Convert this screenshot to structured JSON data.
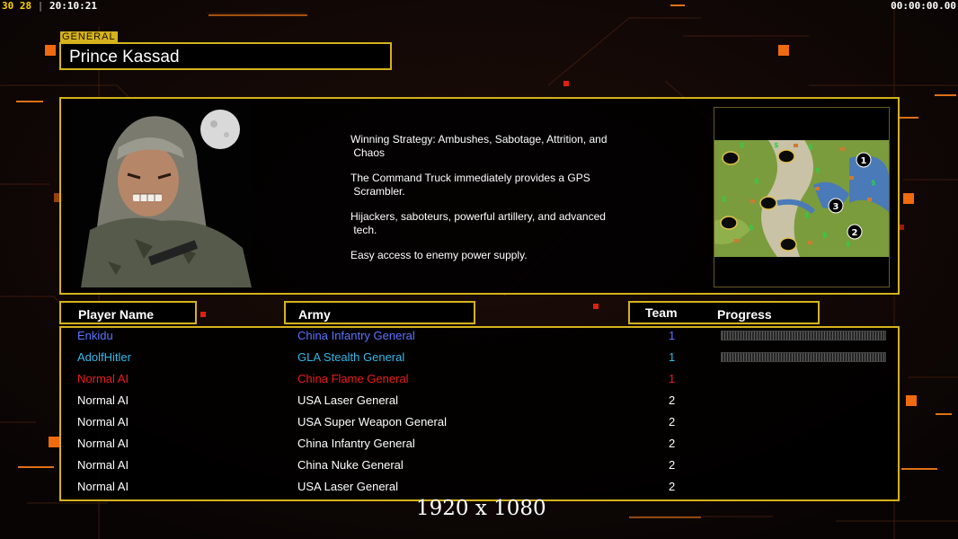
{
  "hud": {
    "fps": "30 28",
    "clock": "20:10:21",
    "timer": "00:00:00.00"
  },
  "general": {
    "label": "GENERAL",
    "name": "Prince Kassad",
    "strategy": [
      "Winning Strategy: Ambushes, Sabotage, Attrition, and\n Chaos",
      "The Command Truck immediately provides a GPS\n Scrambler.",
      "Hijackers, saboteurs, powerful artillery, and advanced\n tech.",
      "Easy access to enemy power supply."
    ]
  },
  "map": {
    "markers": [
      "1",
      "2",
      "3"
    ]
  },
  "table": {
    "headers": {
      "player": "Player Name",
      "army": "Army",
      "team": "Team",
      "progress": "Progress"
    },
    "rows": [
      {
        "player": "Enkidu",
        "army": "China Infantry General",
        "team": "1",
        "color": "#5b73ff",
        "progress": true
      },
      {
        "player": "AdolfHitler",
        "army": "GLA Stealth General",
        "team": "1",
        "color": "#35b8e8",
        "progress": true
      },
      {
        "player": "Normal AI",
        "army": "China Flame General",
        "team": "1",
        "color": "#ee1b1b",
        "progress": false
      },
      {
        "player": "Normal AI",
        "army": "USA Laser General",
        "team": "2",
        "color": "#ffffff",
        "progress": false
      },
      {
        "player": "Normal AI",
        "army": "USA Super Weapon General",
        "team": "2",
        "color": "#ffffff",
        "progress": false
      },
      {
        "player": "Normal AI",
        "army": "China Infantry General",
        "team": "2",
        "color": "#ffffff",
        "progress": false
      },
      {
        "player": "Normal AI",
        "army": "China Nuke General",
        "team": "2",
        "color": "#ffffff",
        "progress": false
      },
      {
        "player": "Normal AI",
        "army": "USA Laser General",
        "team": "2",
        "color": "#ffffff",
        "progress": false
      }
    ]
  },
  "footer": {
    "resolution": "1920 x 1080"
  },
  "colors": {
    "accent": "#d4b21c",
    "team1_accent": "#4f7df0"
  }
}
